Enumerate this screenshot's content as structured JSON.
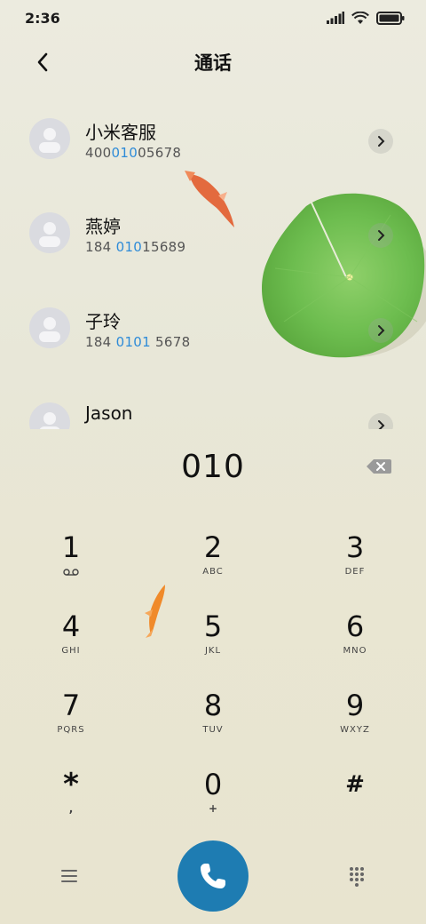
{
  "status_bar": {
    "time": "2:36"
  },
  "header": {
    "title": "通话"
  },
  "contacts": [
    {
      "name": "小米客服",
      "number_pre": "400",
      "number_match": "010",
      "number_post": "05678"
    },
    {
      "name": "燕婷",
      "number_pre": "184 ",
      "number_match": "010",
      "number_post": "15689"
    },
    {
      "name": "子玲",
      "number_pre": "184 ",
      "number_match": "0101",
      "number_post": " 5678"
    },
    {
      "name": "Jason",
      "number_pre": "",
      "number_match": "",
      "number_post": ""
    }
  ],
  "dialer": {
    "input": "010"
  },
  "keypad": [
    {
      "digit": "1",
      "sub": "voicemail-icon"
    },
    {
      "digit": "2",
      "sub": "ABC"
    },
    {
      "digit": "3",
      "sub": "DEF"
    },
    {
      "digit": "4",
      "sub": "GHI"
    },
    {
      "digit": "5",
      "sub": "JKL"
    },
    {
      "digit": "6",
      "sub": "MNO"
    },
    {
      "digit": "7",
      "sub": "PQRS"
    },
    {
      "digit": "8",
      "sub": "TUV"
    },
    {
      "digit": "9",
      "sub": "WXYZ"
    },
    {
      "digit": "*",
      "sub": ","
    },
    {
      "digit": "0",
      "sub": "+"
    },
    {
      "digit": "#",
      "sub": ""
    }
  ],
  "colors": {
    "accent": "#2e8bd8",
    "call_button": "#1e7cb2"
  }
}
